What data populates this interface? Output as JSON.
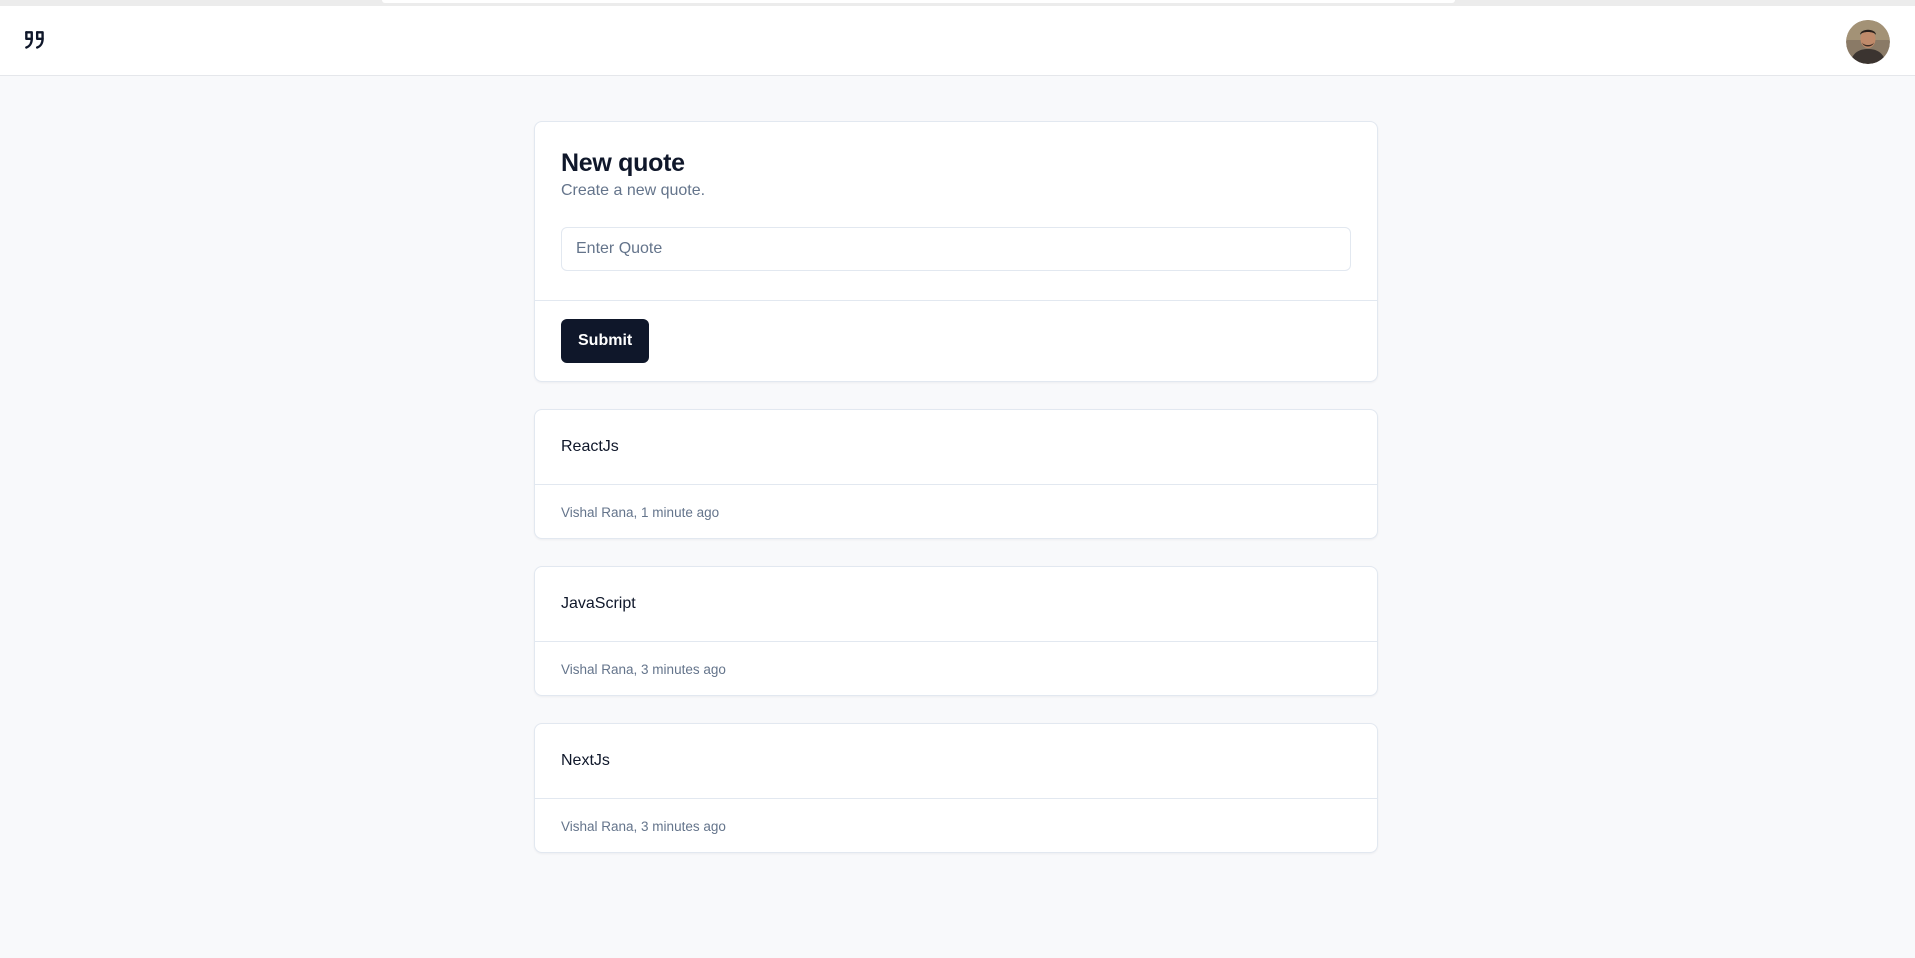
{
  "header": {
    "logo_icon": "quote-icon",
    "avatar_alt": "User avatar"
  },
  "new_quote": {
    "title": "New quote",
    "description": "Create a new quote.",
    "input_placeholder": "Enter Quote",
    "input_value": "",
    "submit_label": "Submit"
  },
  "quotes": [
    {
      "text": "ReactJs",
      "author": "Vishal Rana",
      "time": "1 minute ago",
      "meta": "Vishal Rana, 1 minute ago"
    },
    {
      "text": "JavaScript",
      "author": "Vishal Rana",
      "time": "3 minutes ago",
      "meta": "Vishal Rana, 3 minutes ago"
    },
    {
      "text": "NextJs",
      "author": "Vishal Rana",
      "time": "3 minutes ago",
      "meta": "Vishal Rana, 3 minutes ago"
    }
  ],
  "colors": {
    "primary": "#0f172a",
    "muted": "#64748b",
    "border": "#e2e8f0",
    "background": "#f8f9fb"
  }
}
